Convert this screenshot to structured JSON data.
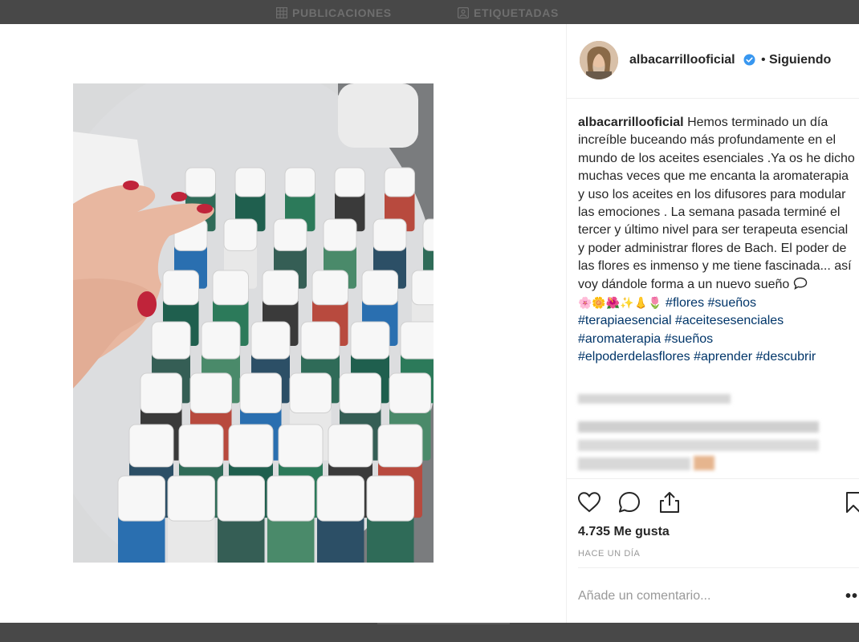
{
  "tabs": {
    "publicaciones": "PUBLICACIONES",
    "etiquetadas": "ETIQUETADAS"
  },
  "post": {
    "username": "albacarrillooficial",
    "separator": "•",
    "follow_status": "Siguiendo",
    "caption_user": "albacarrillooficial",
    "caption_text": "Hemos terminado un día increíble buceando más profundamente en el mundo de los aceites esenciales .Ya os he dicho muchas veces que me encanta la aromaterapia y uso los aceites en los difusores para modular las emociones . La semana pasada terminé el tercer y último nivel para ser terapeuta esencial y poder administrar flores de Bach. El poder de las flores es inmenso y me tiene fascinada... así voy dándole forma a un nuevo sueño",
    "emojis": "🌸🌼🌺✨👃🌷",
    "hashtags": [
      "#flores",
      "#sueños",
      "#terapiaesencial",
      "#aceitesesenciales",
      "#aromaterapia",
      "#sueños",
      "#elpoderdelasflores",
      "#aprender",
      "#descubrir"
    ],
    "likes": "4.735 Me gusta",
    "time": "HACE UN DÍA",
    "comment_placeholder": "Añade un comentario...",
    "more": "••"
  },
  "icons": {
    "grid": "grid-icon",
    "tag": "tag-icon",
    "verified": "verified-badge-icon",
    "heart": "heart-icon",
    "comment": "comment-bubble-icon",
    "share": "share-icon",
    "save": "bookmark-icon",
    "chat": "speech-bubble-icon"
  },
  "colors": {
    "hashtag": "#003569",
    "verified": "#3897f0",
    "muted": "#999999",
    "text": "#262626"
  }
}
